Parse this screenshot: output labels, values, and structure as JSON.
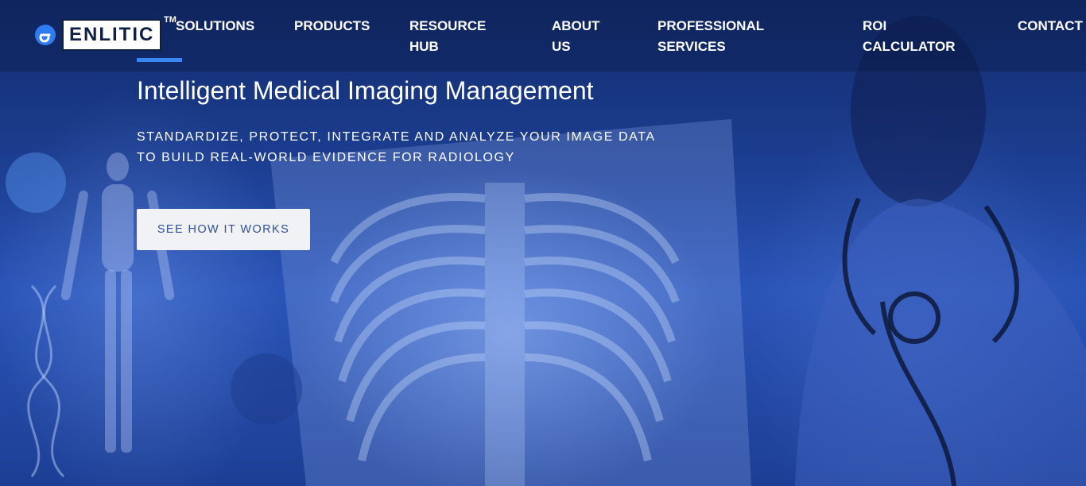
{
  "brand": {
    "logo_text": "ENLITIC",
    "trademark": "TM",
    "accent_color": "#3a86f2"
  },
  "nav": {
    "items": [
      {
        "label": "SOLUTIONS"
      },
      {
        "label": "PRODUCTS"
      },
      {
        "label": "RESOURCE\nHUB"
      },
      {
        "label": "ABOUT\nUS"
      },
      {
        "label": "PROFESSIONAL\nSERVICES"
      },
      {
        "label": "ROI\nCALCULATOR"
      },
      {
        "label": "CONTACT"
      }
    ],
    "active_item": "SOLUTIONS"
  },
  "hero": {
    "headline": "Intelligent Medical Imaging Management",
    "subline_1": "STANDARDIZE, PROTECT, INTEGRATE AND ANALYZE YOUR IMAGE DATA",
    "subline_2": "TO BUILD REAL-WORLD EVIDENCE FOR RADIOLOGY",
    "cta_label": "SEE HOW IT WORKS",
    "background_image": "doctor-holding-chest-xray-blue-tint"
  }
}
